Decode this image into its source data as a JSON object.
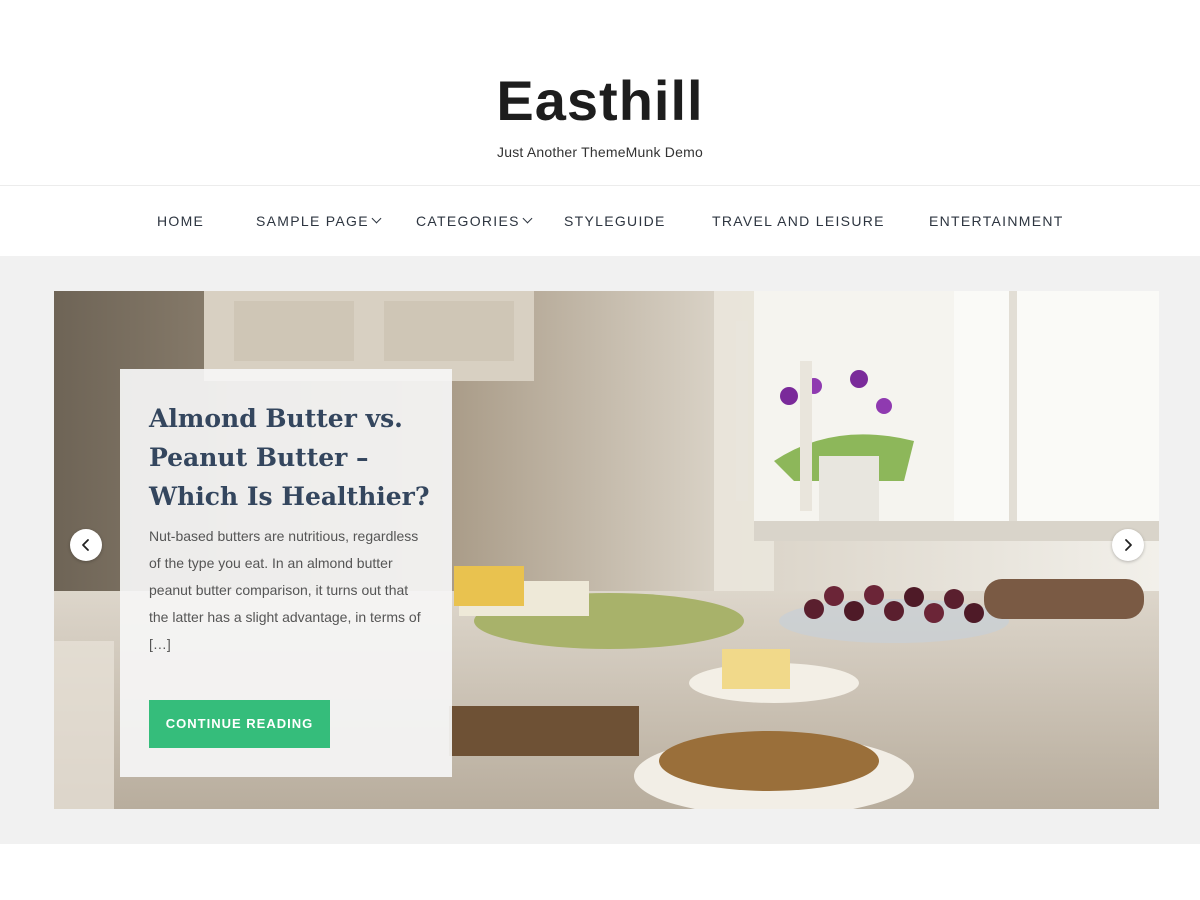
{
  "site": {
    "title": "Easthill",
    "tagline": "Just Another ThemeMunk Demo"
  },
  "nav": {
    "items": [
      {
        "label": "HOME"
      },
      {
        "label": "SAMPLE PAGE"
      },
      {
        "label": "CATEGORIES"
      },
      {
        "label": "STYLEGUIDE"
      },
      {
        "label": "TRAVEL AND LEISURE"
      },
      {
        "label": "ENTERTAINMENT"
      }
    ]
  },
  "slider": {
    "slide": {
      "title": "Almond Butter vs. Peanut Butter – Which Is Healthier?",
      "excerpt": "Nut-based butters are nutritious, regardless of the type you eat. In an almond butter peanut butter comparison, it turns out that the latter has a slight advantage, in terms of […]",
      "button_label": "CONTINUE READING"
    },
    "prev_icon": "chevron-left-icon",
    "next_icon": "chevron-right-icon"
  },
  "colors": {
    "accent": "#35bd7b",
    "heading": "#34465e",
    "band": "#f1f1f1"
  }
}
